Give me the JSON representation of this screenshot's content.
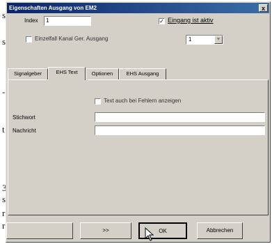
{
  "background": {
    "letters": [
      "s",
      "s",
      "-",
      "t",
      "3",
      "s",
      "r",
      "r"
    ]
  },
  "dialog": {
    "title": "Eigenschaften Ausgang von EM2",
    "close_label": "x",
    "index_label": "Index",
    "index_value": "1",
    "eingang_aktiv_checked": true,
    "eingang_aktiv_label": "Eingang ist aktiv",
    "einzelfall_checked": false,
    "einzelfall_label": "Einzelfall Kanal Ger. Ausgang",
    "combo_value": "1",
    "tabs": [
      "Signalgeber",
      "EHS Text",
      "Optionen",
      "EHS Ausgang"
    ],
    "active_tab": 1,
    "text_option_checked": false,
    "text_option_label": "Text auch bei Fehlern anzeigen",
    "field1_label": "Stichwort",
    "field1_value": "",
    "field2_label": "Nachricht",
    "field2_value": "",
    "buttons": {
      "blank": "",
      "next": ">>",
      "ok": "OK",
      "cancel": "Abbrechen"
    }
  }
}
